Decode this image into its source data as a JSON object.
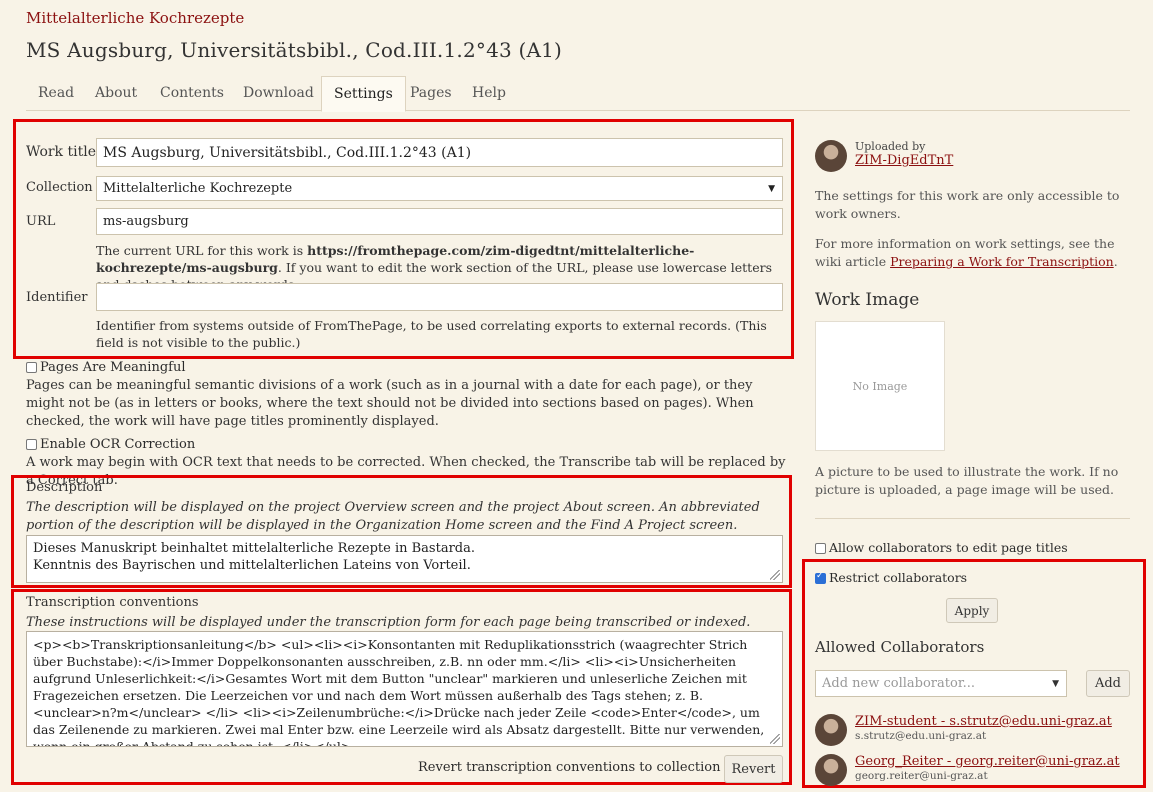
{
  "breadcrumb": "Mittelalterliche Kochrezepte",
  "page_title": "MS Augsburg, Universitätsbibl., Cod.III.1.2°43 (A1)",
  "tabs": [
    "Read",
    "About",
    "Contents",
    "Download",
    "Settings",
    "Pages",
    "Help"
  ],
  "active_tab": "Settings",
  "form": {
    "work_title_label": "Work title",
    "work_title_value": "MS Augsburg, Universitätsbibl., Cod.III.1.2°43 (A1)",
    "collection_label": "Collection",
    "collection_value": "Mittelalterliche Kochrezepte",
    "url_label": "URL",
    "url_value": "ms-augsburg",
    "url_help_pre": "The current URL for this work is ",
    "url_help_link": "https://fromthepage.com/zim-digedtnt/mittelalterliche-kochrezepte/ms-augsburg",
    "url_help_post": ". If you want to edit the work section of the URL, please use lowercase letters and dashes between any words.",
    "identifier_label": "Identifier",
    "identifier_value": "",
    "identifier_help": "Identifier from systems outside of FromThePage, to be used correlating exports to external records. (This field is not visible to the public.)",
    "pages_meaningful_label": "Pages Are Meaningful",
    "pages_meaningful_help": "Pages can be meaningful semantic divisions of a work (such as in a journal with a date for each page), or they might not be (as in letters or books, where the text should not be divided into sections based on pages). When checked, the work will have page titles prominently displayed.",
    "ocr_label": "Enable OCR Correction",
    "ocr_help": "A work may begin with OCR text that needs to be corrected. When checked, the Transcribe tab will be replaced by a Correct tab.",
    "description_label": "Description",
    "description_help": "The description will be displayed on the project Overview screen and the project About screen. An abbreviated portion of the description will be displayed in the Organization Home screen and the Find A Project screen.",
    "description_value_1": "Dieses Manuskript beinhaltet mittelalterliche Rezepte in Bastarda.",
    "description_value_2": "Kenntnis des Bayrischen und mittelalterlichen Lateins von Vorteil.",
    "conventions_label": "Transcription conventions",
    "conventions_help": "These instructions will be displayed under the transcription form for each page being transcribed or indexed.",
    "conventions_value": "<p><b>Transkriptionsanleitung</b> <ul><li><i>Konsontanten mit Reduplikationsstrich (waagrechter Strich über Buchstabe):</i>Immer Doppelkonsonanten ausschreiben, z.B. nn oder mm.</li> <li><i>Unsicherheiten aufgrund Unleserlichkeit:</i>Gesamtes Wort mit dem Button \"unclear\" markieren und unleserliche Zeichen mit Fragezeichen ersetzen. Die Leerzeichen vor und nach dem Wort müssen außerhalb des Tags stehen; z. B. <unclear>n?m</unclear> </li> <li><i>Zeilenumbrüche:</i>Drücke nach jeder Zeile <code>Enter</code>, um das Zeilenende zu markieren. Zwei mal Enter bzw. eine Leerzeile wird als Absatz dargestellt. Bitte nur verwenden, wenn ein großer Abstand zu sehen ist. </li></ul>",
    "revert_text": "Revert transcription conventions to collection default",
    "revert_button": "Revert"
  },
  "sidebar": {
    "uploaded_by_label": "Uploaded by",
    "uploader": "ZIM-DigEdTnT",
    "owners_note": "The settings for this work are only accessible to work owners.",
    "wiki_pre": "For more information on work settings, see the wiki article ",
    "wiki_link": "Preparing a Work for Transcription",
    "wiki_post": ".",
    "work_image_heading": "Work Image",
    "no_image": "No Image",
    "image_help": "A picture to be used to illustrate the work. If no picture is uploaded, a page image will be used.",
    "allow_titles_label": "Allow collaborators to edit page titles",
    "restrict_label": "Restrict collaborators",
    "apply_button": "Apply",
    "collaborators_heading": "Allowed Collaborators",
    "add_placeholder": "Add new collaborator...",
    "add_button": "Add",
    "collaborators": [
      {
        "name": "ZIM-student - s.strutz@edu.uni-graz.at",
        "email": "s.strutz@edu.uni-graz.at"
      },
      {
        "name": "Georg_Reiter - georg.reiter@uni-graz.at",
        "email": "georg.reiter@uni-graz.at"
      }
    ]
  }
}
